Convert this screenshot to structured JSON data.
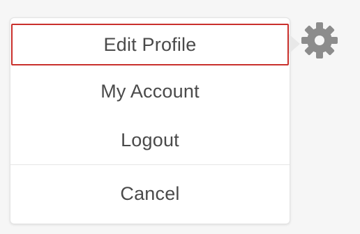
{
  "menu": {
    "items": [
      {
        "label": "Edit Profile",
        "focused": true
      },
      {
        "label": "My Account"
      },
      {
        "label": "Logout"
      }
    ],
    "cancel_label": "Cancel"
  },
  "icons": {
    "settings": "gear-icon"
  },
  "colors": {
    "focus_border": "#c9302c",
    "text": "#4a4a4a",
    "gear": "#8c8c8c"
  }
}
